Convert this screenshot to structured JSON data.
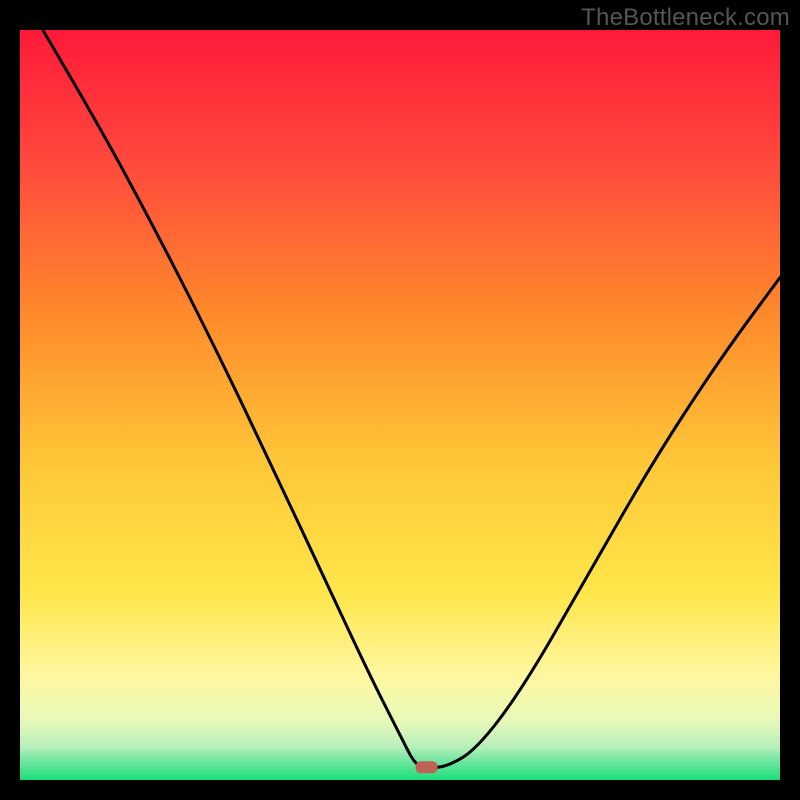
{
  "watermark": "TheBottleneck.com",
  "colors": {
    "top": "#ff1a3a",
    "mid_upper": "#ff8a2b",
    "mid": "#ffd93a",
    "lower": "#fff7a0",
    "band_pale_green": "#c9f5c0",
    "bottom": "#19e07a",
    "curve": "#000000",
    "marker": "#c06158",
    "frame": "#000000"
  },
  "marker": {
    "x_frac": 0.535,
    "y_frac": 0.983
  },
  "chart_data": {
    "type": "line",
    "title": "",
    "xlabel": "",
    "ylabel": "",
    "xlim": [
      0,
      1
    ],
    "ylim": [
      0,
      1
    ],
    "series": [
      {
        "name": "curve",
        "x": [
          0.03,
          0.1,
          0.18,
          0.26,
          0.34,
          0.4,
          0.46,
          0.5,
          0.52,
          0.535,
          0.56,
          0.6,
          0.66,
          0.74,
          0.83,
          0.92,
          1.0
        ],
        "y": [
          1.0,
          0.88,
          0.73,
          0.57,
          0.4,
          0.27,
          0.14,
          0.06,
          0.02,
          0.017,
          0.017,
          0.04,
          0.12,
          0.26,
          0.42,
          0.56,
          0.67
        ]
      }
    ],
    "annotations": [
      {
        "type": "marker",
        "x": 0.535,
        "y": 0.017,
        "shape": "rounded-rect"
      }
    ]
  }
}
